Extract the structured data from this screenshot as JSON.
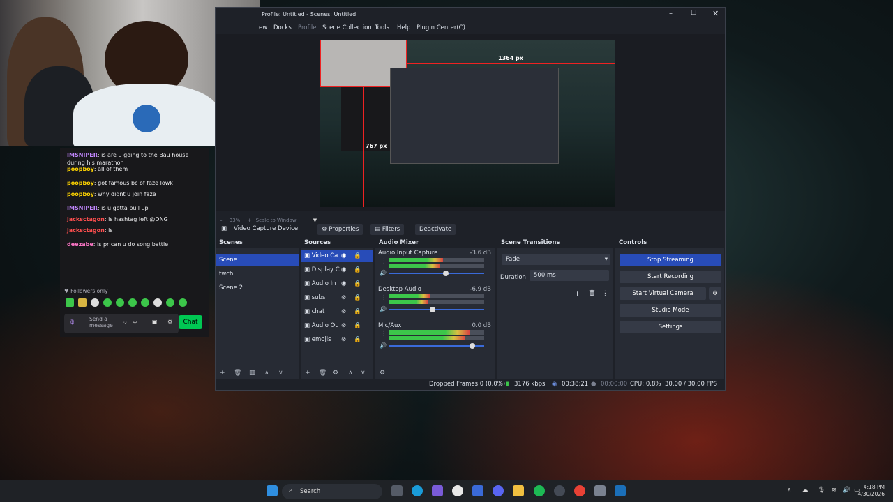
{
  "webcam": {
    "label": "webcam overlay"
  },
  "chat": {
    "messages": [
      {
        "user": "IMSNIPER",
        "text": "is are u going to the Bau house during his marathon",
        "color": "#c287ff"
      },
      {
        "user": "poopboy",
        "text": "all of them",
        "color": "#ffd400"
      },
      {
        "user": "poopboy",
        "text": "got famous bc of faze lowk",
        "color": "#ffd400"
      },
      {
        "user": "poopboy",
        "text": "why didnt u join faze",
        "color": "#ffd400"
      },
      {
        "user": "IMSNIPER",
        "text": "is u gotta pull up",
        "color": "#c287ff"
      },
      {
        "user": "jacksctagon",
        "text": "is hashtag left @DNG",
        "color": "#ff4f4f"
      },
      {
        "user": "jacksctagon",
        "text": "is",
        "color": "#ff4f4f"
      },
      {
        "user": "deezabe",
        "text": "is pr can u do song battle",
        "color": "#ff77c8"
      }
    ],
    "followers_only": "Followers only",
    "input_placeholder": "Send a message",
    "chat_button": "Chat"
  },
  "obs": {
    "title": "Profile: Untitled - Scenes: Untitled",
    "menu": [
      "ew",
      "Docks",
      "Profile",
      "Scene Collection",
      "Tools",
      "Help",
      "Plugin Center(C)"
    ],
    "preview_overlay_w": "1364 px",
    "preview_overlay_h": "767 px",
    "zoom": "33%",
    "scale": "Scale to Window",
    "source_name": "Video Capture Device",
    "properties": "Properties",
    "filters": "Filters",
    "deactivate": "Deactivate",
    "scenes_title": "Scenes",
    "scenes": [
      "Scene",
      "twch",
      "Scene 2"
    ],
    "sources_title": "Sources",
    "sources": [
      "Video Ca",
      "Display C",
      "Audio In",
      "subs",
      "chat",
      "Audio Ou",
      "emojis"
    ],
    "mixer_title": "Audio Mixer",
    "mixer": [
      {
        "name": "Audio Input Capture",
        "db": "-3.6 dB",
        "level": 0.6
      },
      {
        "name": "Desktop Audio",
        "db": "-6.9 dB",
        "level": 0.45
      },
      {
        "name": "Mic/Aux",
        "db": "0.0 dB",
        "level": 0.9
      }
    ],
    "mixer_scale": "-60 -55 -50 -45 -40 -35 -30 -25 -20 -15 -10 -5 0",
    "transitions_title": "Scene Transitions",
    "transition": "Fade",
    "duration_label": "Duration",
    "duration_value": "500 ms",
    "controls_title": "Controls",
    "controls": [
      "Stop Streaming",
      "Start Recording",
      "Start Virtual Camera",
      "Studio Mode",
      "Settings"
    ],
    "status": {
      "dropped": "Dropped Frames 0 (0.0%)",
      "bitrate": "3176 kbps",
      "stream_time": "00:38:21",
      "rec_time": "00:00:00",
      "cpu": "CPU: 0.8%",
      "fps": "30.00 / 30.00 FPS"
    }
  },
  "taskbar": {
    "search": "Search",
    "time": "4:18 PM",
    "date": "4/30/2026"
  },
  "colors": {
    "accent": "#284cb8",
    "twitch_green": "#00c853",
    "obs_bg": "#1e2128"
  }
}
